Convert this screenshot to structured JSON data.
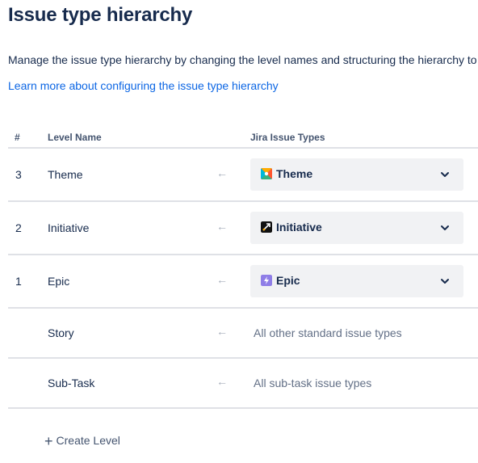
{
  "page": {
    "title": "Issue type hierarchy",
    "description": "Manage the issue type hierarchy by changing the level names and structuring the hierarchy to",
    "learn_more_link": "Learn more about configuring the issue type hierarchy"
  },
  "table": {
    "headers": {
      "number": "#",
      "level_name": "Level Name",
      "jira_issue_types": "Jira Issue Types"
    },
    "rows": [
      {
        "number": "3",
        "level_name": "Theme",
        "arrow": "←",
        "issue_type": "Theme",
        "icon": "theme-icon"
      },
      {
        "number": "2",
        "level_name": "Initiative",
        "arrow": "←",
        "issue_type": "Initiative",
        "icon": "initiative-icon"
      },
      {
        "number": "1",
        "level_name": "Epic",
        "arrow": "←",
        "issue_type": "Epic",
        "icon": "epic-icon"
      },
      {
        "number": "",
        "level_name": "Story",
        "arrow": "←",
        "issue_type": "All other standard issue types"
      },
      {
        "number": "",
        "level_name": "Sub-Task",
        "arrow": "←",
        "issue_type": "All sub-task issue types"
      }
    ]
  },
  "actions": {
    "create_level_icon": "+",
    "create_level_label": "Create Level"
  },
  "colors": {
    "link": "#0c66e4",
    "text": "#172b4d",
    "muted": "#626f86",
    "select_bg": "#f1f2f4",
    "divider": "#dfe1e6",
    "epic": "#8f7ee7"
  }
}
